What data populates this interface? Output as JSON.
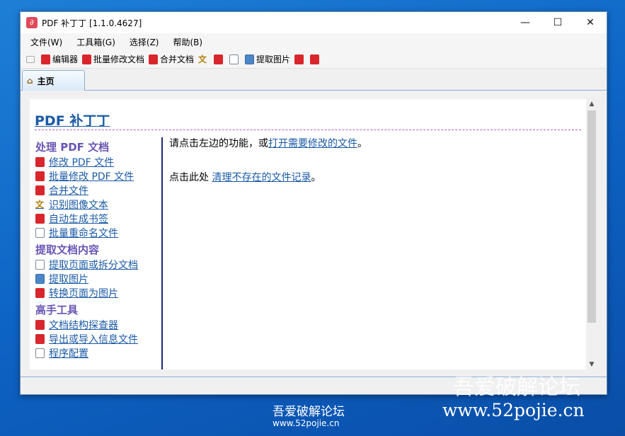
{
  "window": {
    "title": "PDF 补丁丁 [1.1.0.4627]",
    "minimize": "—",
    "maximize": "☐",
    "close": "✕"
  },
  "menu": [
    "文件(W)",
    "工具箱(G)",
    "选择(Z)",
    "帮助(B)"
  ],
  "toolbar": {
    "editor": "编辑器",
    "batch_modify": "批量修改文档",
    "merge": "合并文档",
    "extract_images": "提取图片"
  },
  "tab": {
    "home": "主页"
  },
  "page": {
    "heading": "PDF 补丁丁",
    "sections": [
      {
        "title": "处理 PDF 文档",
        "items": [
          {
            "label": "修改 PDF 文件",
            "icon": "pdf"
          },
          {
            "label": "批量修改 PDF 文件",
            "icon": "pdf"
          },
          {
            "label": "合并文件",
            "icon": "pdf"
          },
          {
            "label": "识别图像文本",
            "icon": "txt"
          },
          {
            "label": "自动生成书签",
            "icon": "pdf"
          },
          {
            "label": "批量重命名文件",
            "icon": "doc"
          }
        ]
      },
      {
        "title": "提取文档内容",
        "items": [
          {
            "label": "提取页面或拆分文档",
            "icon": "doc"
          },
          {
            "label": "提取图片",
            "icon": "img"
          },
          {
            "label": "转换页面为图片",
            "icon": "pdf"
          }
        ]
      },
      {
        "title": "高手工具",
        "items": [
          {
            "label": "文档结构探查器",
            "icon": "pdf"
          },
          {
            "label": "导出或导入信息文件",
            "icon": "pdf"
          },
          {
            "label": "程序配置",
            "icon": "cfg"
          }
        ]
      }
    ],
    "line1_prefix": "请点击左边的功能，或",
    "line1_link": "打开需要修改的文件",
    "line1_suffix": "。",
    "line2_prefix": "点击此处 ",
    "line2_link": "清理不存在的文件记录",
    "line2_suffix": "。"
  },
  "watermark": {
    "name": "吾爱破解论坛",
    "url": "www.52pojie.cn"
  }
}
